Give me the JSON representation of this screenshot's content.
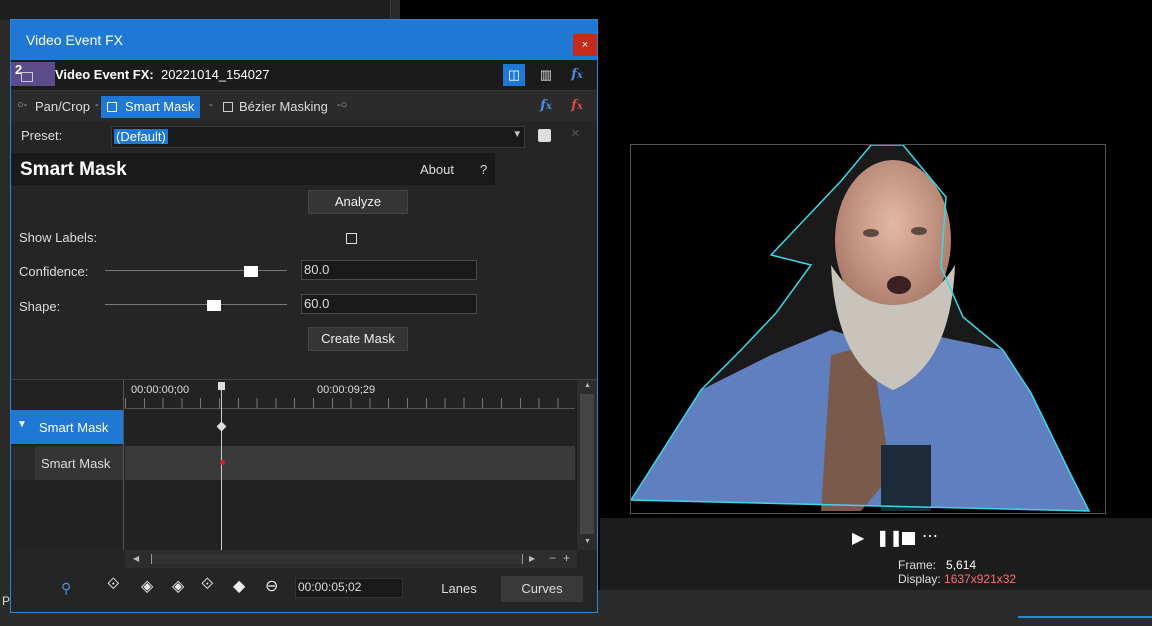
{
  "dialog": {
    "title": "Video Event FX",
    "close_label": "×",
    "badge_number": "2",
    "fx_label": "Video Event FX:",
    "fx_name": "20221014_154027"
  },
  "chain": {
    "items": [
      {
        "label": "Pan/Crop"
      },
      {
        "label": "Smart Mask"
      },
      {
        "label": "Bézier Masking"
      }
    ]
  },
  "preset": {
    "label": "Preset:",
    "value": "(Default)"
  },
  "plugin": {
    "title": "Smart Mask",
    "about_label": "About",
    "help_label": "?",
    "analyze_label": "Analyze",
    "show_labels_label": "Show Labels:",
    "show_labels_checked": false,
    "confidence_label": "Confidence:",
    "confidence_value": "80.0",
    "confidence_fraction": 0.8,
    "shape_label": "Shape:",
    "shape_value": "60.0",
    "shape_fraction": 0.6,
    "create_mask_label": "Create Mask"
  },
  "keyframes": {
    "ruler_start": "00:00:00;00",
    "ruler_end": "00:00:09;29",
    "track_main": "Smart Mask",
    "track_sub": "Smart Mask",
    "timecode": "00:00:05;02",
    "lanes_label": "Lanes",
    "curves_label": "Curves"
  },
  "preview": {
    "frame_label": "Frame:",
    "frame_value": "5,614",
    "display_label": "Display:",
    "display_value": "1637x921x32"
  },
  "status_left": "P",
  "colors": {
    "accent": "#1e78d4",
    "close": "#c42b1c",
    "mask_outline": "#3bd8ea",
    "display_value": "#ff6e6e"
  }
}
